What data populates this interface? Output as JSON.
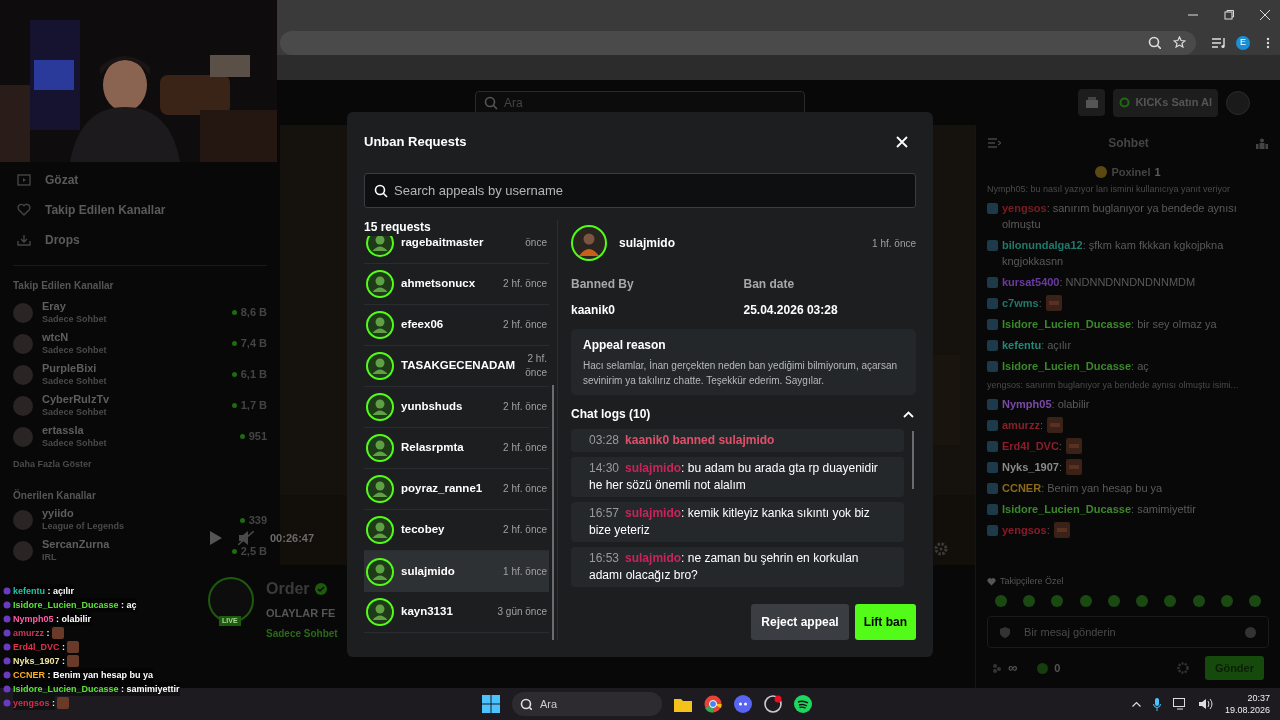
{
  "browser": {
    "profile": "E"
  },
  "header": {
    "search_placeholder": "Ara",
    "kicks_button": "KICKs Satın Al"
  },
  "sidebar": {
    "nav": [
      {
        "label": "Gözat",
        "kind": "browse"
      },
      {
        "label": "Takip Edilen Kanallar",
        "kind": "heart"
      },
      {
        "label": "Drops",
        "kind": "drops"
      }
    ],
    "followed_title": "Takip Edilen Kanallar",
    "followed": [
      {
        "name": "Eray",
        "category": "Sadece Sohbet",
        "viewers": "8,6 B"
      },
      {
        "name": "wtcN",
        "category": "Sadece Sohbet",
        "viewers": "7,4 B"
      },
      {
        "name": "PurpleBixi",
        "category": "Sadece Sohbet",
        "viewers": "6,1 B"
      },
      {
        "name": "CyberRulzTv",
        "category": "Sadece Sohbet",
        "viewers": "1,7 B"
      },
      {
        "name": "ertassla",
        "category": "Sadece Sohbet",
        "viewers": "951"
      }
    ],
    "show_more": "Daha Fazla Göster",
    "recommended_title": "Önerilen Kanallar",
    "recommended": [
      {
        "name": "yyiido",
        "category": "League of Legends",
        "viewers": "339"
      },
      {
        "name": "SercanZurna",
        "category": "IRL",
        "viewers": "2,5 B"
      }
    ]
  },
  "player": {
    "time": "00:26:47",
    "streamer": "Order",
    "live_badge": "LIVE",
    "title": "OLAYLAR FE",
    "category": "Sadece Sohbet"
  },
  "chat": {
    "title": "Sohbet",
    "pinned_user": "Poxinel",
    "pinned_count": "1",
    "separator": ":",
    "messages": [
      {
        "user": "yengsos",
        "color": "#7a1c22",
        "text": "sanırım buglanıyor ya bendede aynısı olmuştu",
        "reply": "Nymph05: bu nasıl yazıyor lan ismini kullanıcıya yanıt veriyor",
        "emote": false
      },
      {
        "user": "bilonundalga12",
        "color": "#1f7a6b",
        "text": "şfkm kam fkkkan kgkojpkna kngjokkasnn",
        "emote": false
      },
      {
        "user": "kursat5400",
        "color": "#6b3aa0",
        "text": "NNDNNDNNDNDNNMDM",
        "emote": false
      },
      {
        "user": "c7wms",
        "color": "#1f7a6b",
        "emote": true
      },
      {
        "user": "Isidore_Lucien_Ducasse",
        "color": "#3a8a2a",
        "text": "bir sey olmaz ya",
        "emote": false
      },
      {
        "user": "kefentu",
        "color": "#1f8a7a",
        "text": "açılır",
        "emote": false
      },
      {
        "user": "Isidore_Lucien_Ducasse",
        "color": "#3a8a2a",
        "text": "aç",
        "emote": false
      },
      {
        "user": "Nymph05",
        "color": "#7a4aa8",
        "text": "olabilir",
        "reply": "yengsos: sanırım buglanıyor ya bendede aynısı olmuştu isimi...",
        "emote": false
      },
      {
        "user": "amurzz",
        "color": "#8a1f2a",
        "emote": true
      },
      {
        "user": "Erd4l_DVC",
        "color": "#8a1f2a",
        "emote": true
      },
      {
        "user": "Nyks_1907",
        "color": "#8a8a8a",
        "emote": true
      },
      {
        "user": "CCNER",
        "color": "#8a6a1a",
        "text": "Benim yan hesap bu ya",
        "emote": false
      },
      {
        "user": "Isidore_Lucien_Ducasse",
        "color": "#3a8a2a",
        "text": "samimiyettir",
        "emote": false
      },
      {
        "user": "yengsos",
        "color": "#8a1a2a",
        "emote": true
      }
    ],
    "followers_only": "Takipçilere Özel",
    "input_placeholder": "Bir mesaj gönderin",
    "infinity": "∞",
    "kicks_count": "0",
    "send_button": "Gönder"
  },
  "overlay_chat": {
    "separator": ":",
    "messages": [
      {
        "user": "kefentu",
        "color": "#21c4a8",
        "text": "açılır",
        "emote": false
      },
      {
        "user": "Isidore_Lucien_Ducasse",
        "color": "#5ce23a",
        "text": "aç",
        "emote": false
      },
      {
        "user": "Nymph05",
        "color": "#ff5ca8",
        "text": "olabilir",
        "emote": false
      },
      {
        "user": "amurzz",
        "color": "#d0335a",
        "emote": true
      },
      {
        "user": "Erd4l_DVC",
        "color": "#e0304a",
        "emote": true
      },
      {
        "user": "Nyks_1907",
        "color": "#f0e6a0",
        "emote": true
      },
      {
        "user": "CCNER",
        "color": "#ffb020",
        "text": "Benim yan hesap bu ya",
        "emote": false
      },
      {
        "user": "Isidore_Lucien_Ducasse",
        "color": "#5ce23a",
        "text": "samimiyettir",
        "emote": false
      },
      {
        "user": "yengsos",
        "color": "#d03050",
        "emote": true
      }
    ]
  },
  "modal": {
    "title": "Unban Requests",
    "search_placeholder": "Search appeals by username",
    "count": "15 requests",
    "requests": [
      {
        "name": "ragebaitmaster",
        "time": "önce",
        "selected": false
      },
      {
        "name": "ahmetsonucx",
        "time": "2 hf. önce",
        "selected": false
      },
      {
        "name": "efeex06",
        "time": "2 hf. önce",
        "selected": false
      },
      {
        "name": "TASAKGECENADAM",
        "time": "2 hf. önce",
        "selected": false
      },
      {
        "name": "yunbshuds",
        "time": "2 hf. önce",
        "selected": false
      },
      {
        "name": "Relasrpmta",
        "time": "2 hf. önce",
        "selected": false
      },
      {
        "name": "poyraz_ranne1",
        "time": "2 hf. önce",
        "selected": false
      },
      {
        "name": "tecobey",
        "time": "2 hf. önce",
        "selected": false
      },
      {
        "name": "sulajmido",
        "time": "1 hf. önce",
        "selected": true
      },
      {
        "name": "kayn3131",
        "time": "3 gün önce",
        "selected": false
      }
    ],
    "detail": {
      "user": "sulajmido",
      "time": "1 hf. önce",
      "banned_by_label": "Banned By",
      "banned_by": "kaanik0",
      "ban_date_label": "Ban date",
      "ban_date": "25.04.2026 03:28",
      "appeal_title": "Appeal reason",
      "appeal_text": "Hacı selamlar, İnan gerçekten neden ban yediğimi bilmiyorum, açarsan sevinirim ya takılırız chatte. Teşekkür ederim. Saygılar.",
      "logs_title": "Chat logs (10)",
      "logs_expanded": true,
      "separator": ":",
      "logs": [
        {
          "kind": "ban",
          "time": "03:28",
          "text": "kaanik0 banned sulajmido"
        },
        {
          "kind": "message",
          "time": "14:30",
          "user": "sulajmido",
          "text": "bu adam bu arada gta rp duayenidir he her sözü önemli not alalım"
        },
        {
          "kind": "message",
          "time": "16:57",
          "user": "sulajmido",
          "text": "kemik kitleyiz kanka sıkıntı yok biz bize yeteriz"
        },
        {
          "kind": "message",
          "time": "16:53",
          "user": "sulajmido",
          "text": "ne zaman bu şehrin en korkulan adamı olacağız bro?"
        }
      ]
    },
    "reject_button": "Reject appeal",
    "lift_button": "Lift ban"
  },
  "taskbar": {
    "search_placeholder": "Ara",
    "time": "20:37",
    "date": "19.08.2026"
  }
}
